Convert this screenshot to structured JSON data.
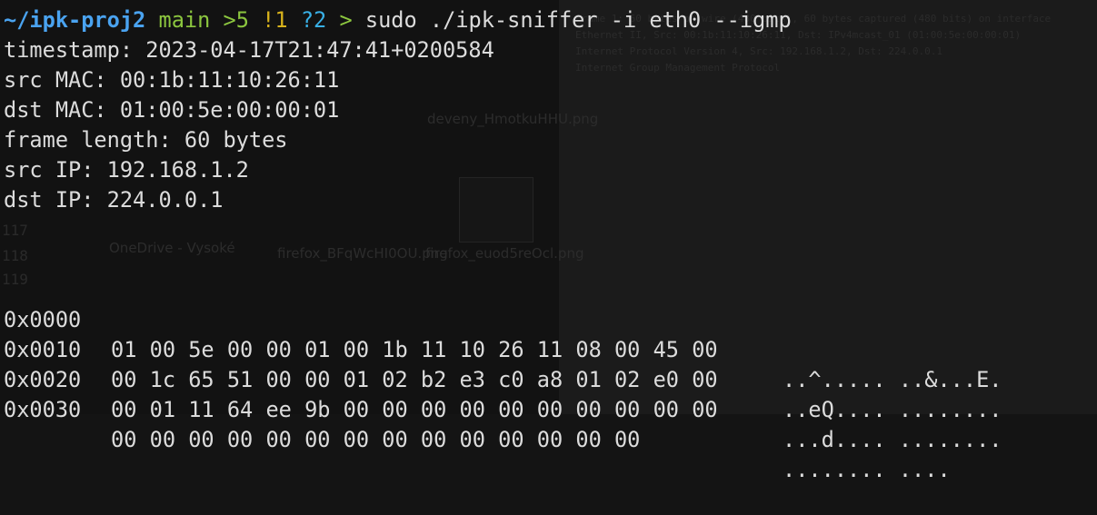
{
  "prompt": {
    "path": "~/ipk-proj2",
    "branch": "main",
    "ahead": ">5",
    "modified": "!1",
    "untracked": "?2",
    "symbol": ">",
    "command": "sudo ./ipk-sniffer -i eth0 --igmp"
  },
  "packet": {
    "timestamp": "timestamp: 2023-04-17T21:47:41+0200584",
    "src_mac": "src MAC: 00:1b:11:10:26:11",
    "dst_mac": "dst MAC: 01:00:5e:00:00:01",
    "frame_length": "frame length: 60 bytes",
    "src_ip": "src IP: 192.168.1.2",
    "dst_ip": "dst IP: 224.0.0.1"
  },
  "hexdump": [
    {
      "offset": "0x0000",
      "bytes": "01 00 5e 00 00 01 00 1b 11 10 26 11 08 00 45 00",
      "ascii": "..^..... ..&...E."
    },
    {
      "offset": "0x0010",
      "bytes": "00 1c 65 51 00 00 01 02 b2 e3 c0 a8 01 02 e0 00",
      "ascii": "..eQ.... ........"
    },
    {
      "offset": "0x0020",
      "bytes": "00 01 11 64 ee 9b 00 00 00 00 00 00 00 00 00 00",
      "ascii": "...d.... ........"
    },
    {
      "offset": "0x0030",
      "bytes": "00 00 00 00 00 00 00 00 00 00 00 00 00 00",
      "ascii": "........ ...."
    }
  ],
  "background": {
    "ghost_files": [
      "deveny_HmotkuHHU.png",
      "firefox_BFqWcHI0OU.png",
      "firefox_euod5reOcl.png",
      "OneDrive - Vysoké"
    ],
    "ghost_line_numbers": [
      "117",
      "118",
      "119"
    ],
    "wireshark_lines": [
      "Frame 1: 60 bytes on wire (480 bits), 60 bytes captured (480 bits) on interface",
      "Ethernet II, Src: 00:1b:11:10:26:11, Dst: IPv4mcast_01 (01:00:5e:00:00:01)",
      "Internet Protocol Version 4, Src: 192.168.1.2, Dst: 224.0.0.1",
      "Internet Group Management Protocol"
    ]
  }
}
